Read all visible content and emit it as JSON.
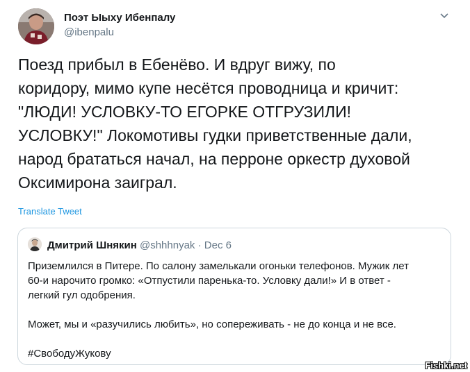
{
  "author": {
    "name": "Поэт Ыыху Ибенпалу",
    "handle": "@ibenpalu"
  },
  "tweet": {
    "lines": [
      "Поезд прибыл в Ебенёво. И вдруг вижу, по",
      "коридору, мимо купе несётся проводница и кричит:",
      "\"ЛЮДИ! УСЛОВКУ-ТО ЕГОРКЕ ОТГРУЗИЛИ!",
      "УСЛОВКУ!\" Локомотивы гудки приветственные дали,",
      "народ брататься начал, на перроне оркестр духовой",
      "Оксимирона заиграл."
    ],
    "translate_label": "Translate Tweet"
  },
  "quote": {
    "name": "Дмитрий Шнякин",
    "handle": "@shhhnyak",
    "separator": "·",
    "date": "Dec 6",
    "paragraph1": [
      "Приземлился в Питере. По салону замелькали огоньки телефонов. Мужик лет",
      "60-и нарочито громко: «Отпустили паренька-то. Условку дали!» И в ответ -",
      "легкий гул одобрения."
    ],
    "paragraph2": "Может, мы и «разучились любить», но сопереживать - не до конца и не все.",
    "hashtag": "#СвободуЖукову"
  },
  "watermark": "Fishki.net",
  "icons": {
    "more": "chevron-down-icon"
  },
  "colors": {
    "link": "#1b95e0",
    "secondary_text": "#657786",
    "border": "#ccd6dd"
  }
}
